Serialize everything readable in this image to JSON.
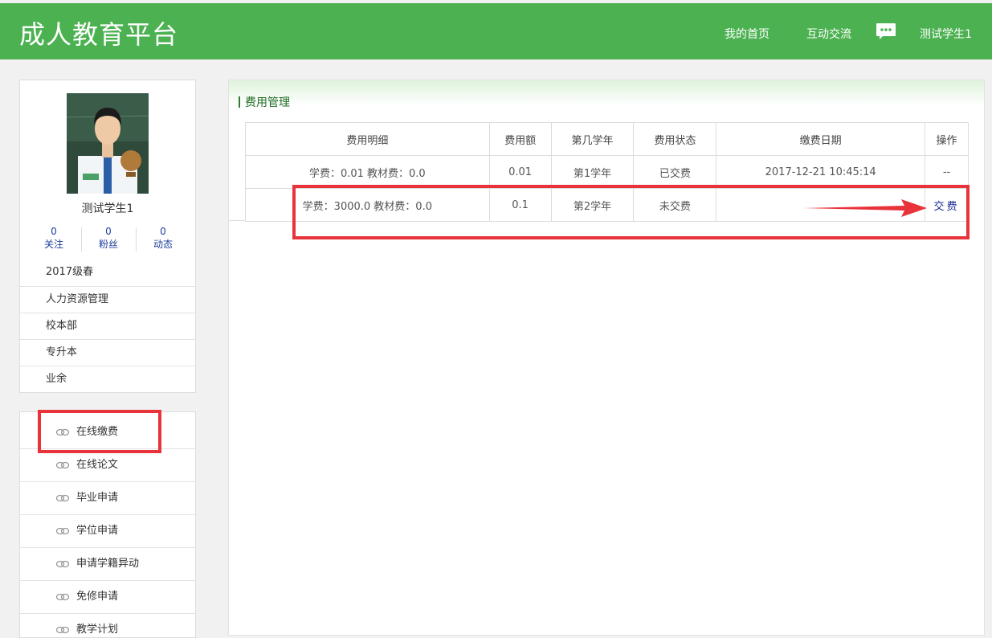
{
  "header": {
    "logo": "成人教育平台",
    "nav": {
      "home": "我的首页",
      "exchange": "互动交流",
      "user": "测试学生1"
    }
  },
  "profile": {
    "name": "测试学生1",
    "stats": [
      {
        "count": "0",
        "label": "关注"
      },
      {
        "count": "0",
        "label": "粉丝"
      },
      {
        "count": "0",
        "label": "动态"
      }
    ],
    "menu": [
      "2017级春",
      "人力资源管理",
      "校本部",
      "专升本",
      "业余"
    ]
  },
  "functions": [
    "在线缴费",
    "在线论文",
    "毕业申请",
    "学位申请",
    "申请学籍异动",
    "免修申请",
    "教学计划"
  ],
  "panel": {
    "title": "费用管理",
    "headers": [
      "费用明细",
      "费用额",
      "第几学年",
      "费用状态",
      "缴费日期",
      "操作"
    ],
    "rows": [
      {
        "detail": "学费：0.01  教材费：0.0",
        "amount": "0.01",
        "year": "第1学年",
        "status": "已交费",
        "date": "2017-12-21 10:45:14",
        "action": "--"
      },
      {
        "detail": "学费：3000.0  教材费：0.0",
        "amount": "0.1",
        "year": "第2学年",
        "status": "未交费",
        "date": "",
        "action": "交费"
      }
    ]
  },
  "colors": {
    "brand_green": "#4cb151",
    "highlight_red": "#e8333b",
    "link_blue": "#1b2f95"
  }
}
